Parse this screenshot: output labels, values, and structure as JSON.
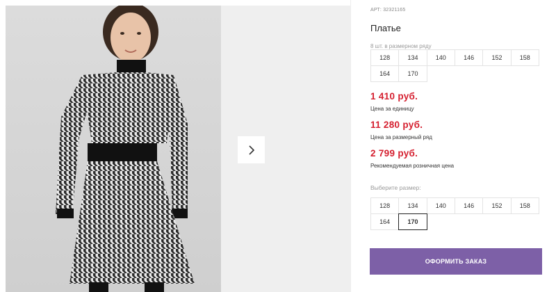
{
  "product": {
    "article": "АРТ: 32321165",
    "title": "Платье",
    "series_hint": "8 шт. в размерном ряду",
    "series_sizes": [
      [
        "128",
        "134",
        "140",
        "146",
        "152",
        "158"
      ],
      [
        "164",
        "170"
      ]
    ],
    "prices": [
      {
        "value": "1 410 руб.",
        "caption": "Цена за единицу"
      },
      {
        "value": "11 280 руб.",
        "caption": "Цена за размерный ряд"
      },
      {
        "value": "2 799 руб.",
        "caption": "Рекомендуемая розничная цена"
      }
    ],
    "choose_label": "Выберите размер:",
    "pick_sizes": [
      [
        "128",
        "134",
        "140",
        "146",
        "152",
        "158"
      ],
      [
        "164",
        "170"
      ]
    ],
    "selected_size": "170",
    "order_button": "ОФОРМИТЬ ЗАКАЗ"
  },
  "gallery": {
    "next_icon": "chevron-right-icon"
  },
  "colors": {
    "price": "#d51f2f",
    "order_button": "#7d60a7"
  }
}
